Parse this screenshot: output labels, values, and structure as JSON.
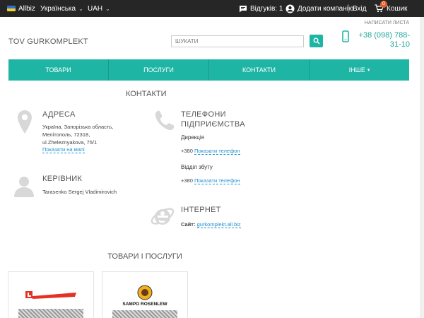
{
  "topbar": {
    "brand": "Allbiz",
    "language": "Українська",
    "currency": "UAH",
    "reviews": "Відгуків: 1",
    "add_company": "Додати компанію",
    "login": "Вхід",
    "cart": "Кошик",
    "cart_count": "0"
  },
  "header": {
    "send_letter": "НАПИСАТИ ЛИСТА",
    "company_name": "TOV GURKOMPLEKT",
    "search_placeholder": "ШУКАТИ",
    "phone": "+38 (098) 788-31-10"
  },
  "nav": {
    "tabs": [
      "ТОВАРИ",
      "ПОСЛУГИ",
      "КОНТАКТИ",
      "ІНШЕ"
    ]
  },
  "contacts": {
    "heading": "КОНТАКТИ",
    "address": {
      "title": "АДРЕСА",
      "line1": "Україна, Запорізька область,",
      "line2": "Мелітополь, 72318,",
      "line3": "ul.Zheleznyakova, 75/1",
      "map_link": "Показати на мапі"
    },
    "manager": {
      "title": "КЕРІВНИК",
      "name": "Tarasenko Sergej Vladimirovich"
    },
    "phones": {
      "title_line1": "ТЕЛЕФОНИ",
      "title_line2": "ПІДПРИЄМСТВА",
      "dept1": "Дирекція",
      "dept1_prefix": "+380",
      "dept1_link": "Показати телефон",
      "dept2": "Відділ збуту",
      "dept2_prefix": "+380",
      "dept2_link": "Показати телефон"
    },
    "internet": {
      "title": "ІНТЕРНЕТ",
      "site_label": "Сайт:",
      "site": "gurkomplekt.all.biz"
    }
  },
  "goods": {
    "heading": "ТОВАРИ І ПОСЛУГИ",
    "cards": [
      {
        "brand": "LUVENDA"
      },
      {
        "brand": "SAMPO ROSENLEW"
      }
    ]
  },
  "colors": {
    "accent": "#1fb5a4",
    "topbar": "#262626",
    "link": "#1f8fcf"
  }
}
